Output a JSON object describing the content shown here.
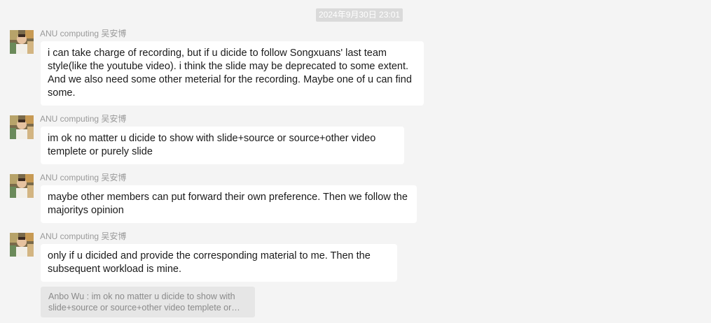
{
  "timestamp": "2024年9月30日 23:01",
  "messages": [
    {
      "sender": "ANU computing 吴安博",
      "text": "i can take charge of recording, but if u dicide to follow Songxuans' last team style(like the youtube video). i think the slide may be deprecated to some extent. And we also need some other meterial for the recording. Maybe one of u can find some."
    },
    {
      "sender": "ANU computing 吴安博",
      "text": "im ok no matter u dicide to show with slide+source or source+other video templete or purely slide"
    },
    {
      "sender": "ANU computing 吴安博",
      "text": "maybe other members can put forward their own preference. Then we follow the majoritys opinion"
    },
    {
      "sender": "ANU computing 吴安博",
      "text": "only if u dicided and provide the corresponding material to me. Then the subsequent workload is mine."
    }
  ],
  "quote": {
    "text": "Anbo Wu : im ok no matter u dicide to show with slide+source or source+other video templete or purely slide"
  },
  "colors": {
    "background": "#f4f4f4",
    "bubble": "#ffffff",
    "sender": "#9a9a9a",
    "quote_bg": "#e6e6e6"
  }
}
